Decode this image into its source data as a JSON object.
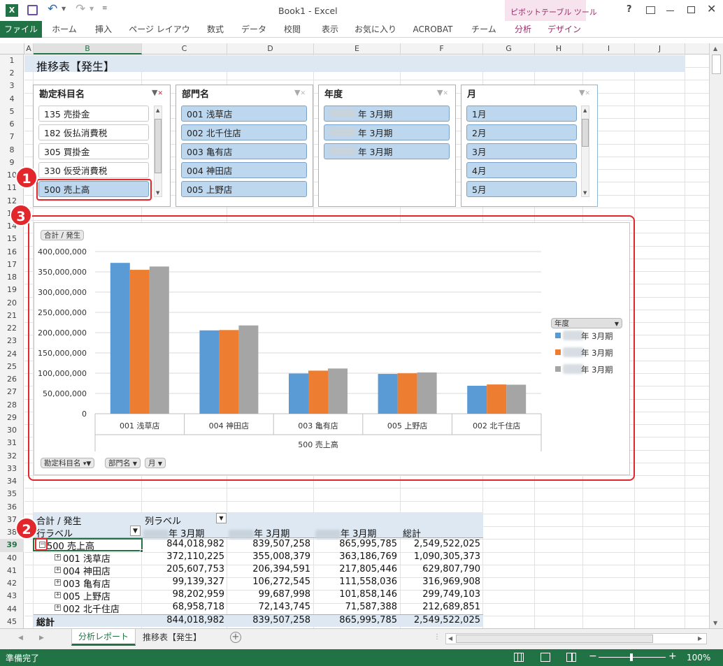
{
  "window": {
    "title": "Book1 - Excel",
    "context_tab_group": "ピボットテーブル ツール"
  },
  "ribbon": {
    "tabs": [
      "ファイル",
      "ホーム",
      "挿入",
      "ページ レイアウト",
      "数式",
      "データ",
      "校閲",
      "表示",
      "お気に入り",
      "ACROBAT",
      "チーム",
      "分析",
      "デザイン"
    ]
  },
  "columns": [
    "A",
    "B",
    "C",
    "D",
    "E",
    "F",
    "G",
    "H",
    "I",
    "J"
  ],
  "rows": [
    "1",
    "2",
    "3",
    "4",
    "5",
    "6",
    "7",
    "8",
    "9",
    "10",
    "11",
    "12",
    "13",
    "14",
    "15",
    "16",
    "17",
    "18",
    "19",
    "20",
    "21",
    "22",
    "23",
    "24",
    "25",
    "26",
    "27",
    "28",
    "29",
    "30",
    "31",
    "32",
    "33",
    "34",
    "35",
    "36",
    "37",
    "38",
    "39",
    "40",
    "41",
    "42",
    "43",
    "44",
    "45"
  ],
  "sheet_title": "推移表【発生】",
  "slicers": [
    {
      "header": "勘定科目名",
      "items": [
        "135 売掛金",
        "182 仮払消費税",
        "305 買掛金",
        "330 仮受消費税",
        "500 売上高"
      ],
      "selected": [
        false,
        false,
        false,
        false,
        true
      ]
    },
    {
      "header": "部門名",
      "items": [
        "001 浅草店",
        "002 北千住店",
        "003 亀有店",
        "004 神田店",
        "005 上野店"
      ],
      "selected": [
        true,
        true,
        true,
        true,
        true
      ]
    },
    {
      "header": "年度",
      "items": [
        "年 3月期",
        "年 3月期",
        "年 3月期"
      ],
      "selected": [
        true,
        true,
        true
      ]
    },
    {
      "header": "月",
      "items": [
        "1月",
        "2月",
        "3月",
        "4月",
        "5月"
      ],
      "selected": [
        true,
        true,
        true,
        true,
        true
      ]
    }
  ],
  "badges": [
    "1",
    "2",
    "3"
  ],
  "chart_data": {
    "type": "bar",
    "title": "",
    "value_button": "合計 / 発生",
    "categories": [
      "001 浅草店",
      "004 神田店",
      "003 亀有店",
      "005 上野店",
      "002 北千住店"
    ],
    "group_label": "500 売上高",
    "series": [
      {
        "name": "年 3月期",
        "color": "#5b9bd5",
        "values": [
          372110225,
          205607753,
          99139327,
          98202959,
          68958718
        ]
      },
      {
        "name": "年 3月期",
        "color": "#ed7d31",
        "values": [
          355008379,
          206394591,
          106272545,
          99687998,
          72143745
        ]
      },
      {
        "name": "年 3月期",
        "color": "#a5a5a5",
        "values": [
          363186769,
          217805446,
          111558036,
          101858146,
          71587388
        ]
      }
    ],
    "yticks": [
      "400,000,000",
      "350,000,000",
      "300,000,000",
      "250,000,000",
      "200,000,000",
      "150,000,000",
      "100,000,000",
      "50,000,000",
      "0"
    ],
    "ylim": [
      0,
      400000000
    ],
    "legend_title": "年度",
    "legend_position": "right",
    "grid": true,
    "field_buttons": [
      "勘定科目名",
      "部門名",
      "月"
    ]
  },
  "pivot": {
    "corner": "合計 / 発生",
    "col_label": "列ラベル",
    "row_label": "行ラベル",
    "col_heads": [
      "年 3月期",
      "年 3月期",
      "年 3月期",
      "総計"
    ],
    "rows": [
      {
        "label": "500 売上高",
        "vals": [
          "844,018,982",
          "839,507,258",
          "865,995,785",
          "2,549,522,025"
        ]
      },
      {
        "label": "001 浅草店",
        "vals": [
          "372,110,225",
          "355,008,379",
          "363,186,769",
          "1,090,305,373"
        ]
      },
      {
        "label": "004 神田店",
        "vals": [
          "205,607,753",
          "206,394,591",
          "217,805,446",
          "629,807,790"
        ]
      },
      {
        "label": "003 亀有店",
        "vals": [
          "99,139,327",
          "106,272,545",
          "111,558,036",
          "316,969,908"
        ]
      },
      {
        "label": "005 上野店",
        "vals": [
          "98,202,959",
          "99,687,998",
          "101,858,146",
          "299,749,103"
        ]
      },
      {
        "label": "002 北千住店",
        "vals": [
          "68,958,718",
          "72,143,745",
          "71,587,388",
          "212,689,851"
        ]
      }
    ],
    "total_label": "総計",
    "total_vals": [
      "844,018,982",
      "839,507,258",
      "865,995,785",
      "2,549,522,025"
    ]
  },
  "sheet_tabs": [
    "分析レポート",
    "推移表【発生】"
  ],
  "status": {
    "text": "準備完了",
    "zoom": "100%"
  }
}
